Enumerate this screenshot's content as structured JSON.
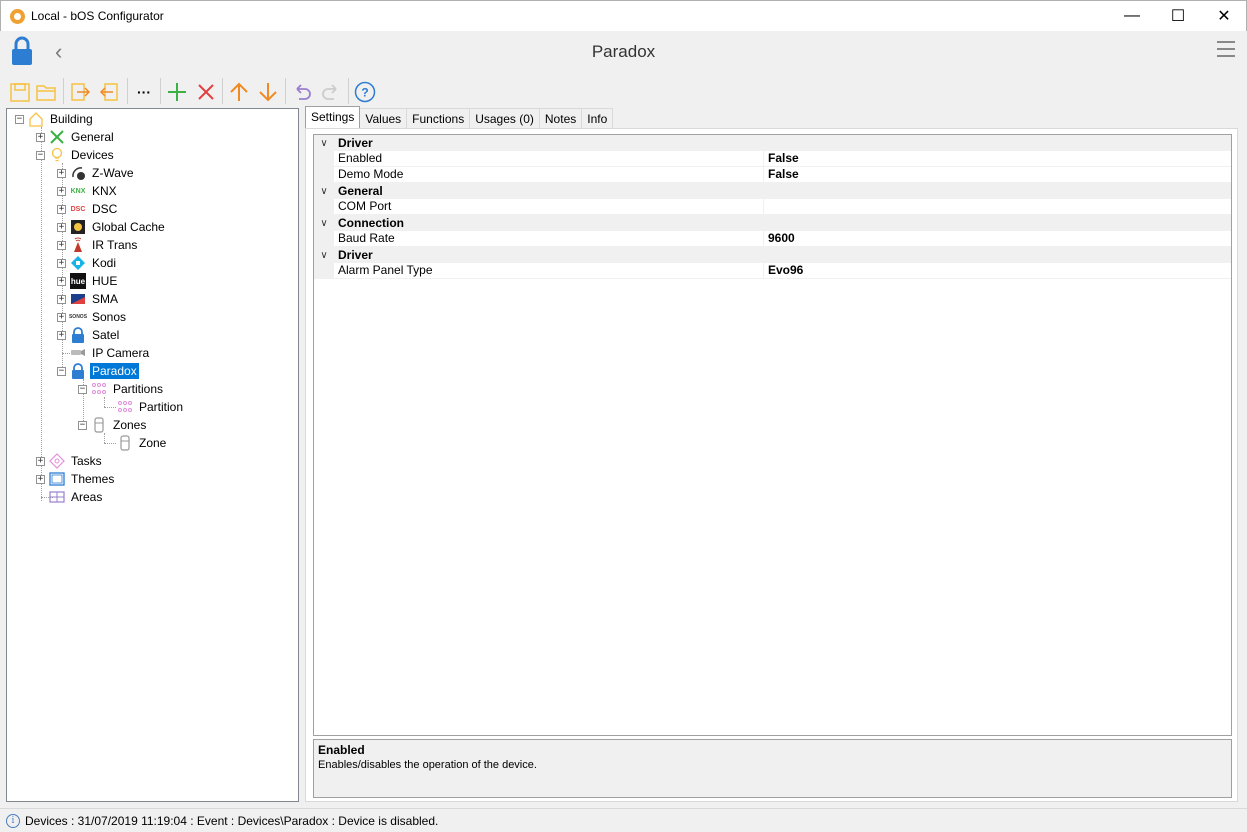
{
  "window": {
    "title": "Local - bOS Configurator",
    "minimize": "—",
    "maximize": "☐",
    "close": "✕"
  },
  "header": {
    "title": "Paradox",
    "back_icon": "chevron-left-icon",
    "menu_icon": "hamburger-icon"
  },
  "toolbar": {
    "more_label": "···"
  },
  "tree": {
    "root": "Building",
    "general": "General",
    "devices": "Devices",
    "items": [
      "Z-Wave",
      "KNX",
      "DSC",
      "Global Cache",
      "IR Trans",
      "Kodi",
      "HUE",
      "SMA",
      "Sonos",
      "Satel",
      "IP Camera",
      "Paradox"
    ],
    "partitions": "Partitions",
    "partition": "Partition",
    "zones": "Zones",
    "zone": "Zone",
    "tasks": "Tasks",
    "themes": "Themes",
    "areas": "Areas",
    "icon_labels": {
      "knx": "KNX",
      "dsc": "DSC",
      "sonos": "SONOS",
      "hue": "hue"
    }
  },
  "tabs": [
    "Settings",
    "Values",
    "Functions",
    "Usages (0)",
    "Notes",
    "Info"
  ],
  "properties": {
    "cat1": "Driver",
    "enabled_name": "Enabled",
    "enabled_value": "False",
    "demo_name": "Demo Mode",
    "demo_value": "False",
    "cat2": "General",
    "com_name": "COM Port",
    "com_value": "",
    "cat3": "Connection",
    "baud_name": "Baud Rate",
    "baud_value": "9600",
    "cat4": "Driver",
    "alarm_name": "Alarm Panel Type",
    "alarm_value": "Evo96"
  },
  "description": {
    "title": "Enabled",
    "text": "Enables/disables the operation of the device."
  },
  "status": {
    "text": "Devices : 31/07/2019 11:19:04 : Event : Devices\\Paradox : Device is disabled."
  },
  "colors": {
    "selection": "#0078d7",
    "lock_blue": "#2d7dd2",
    "add_green": "#3cb043",
    "delete_red": "#e04040",
    "arrow_orange": "#f08a24",
    "folder_yellow": "#f5c242"
  }
}
